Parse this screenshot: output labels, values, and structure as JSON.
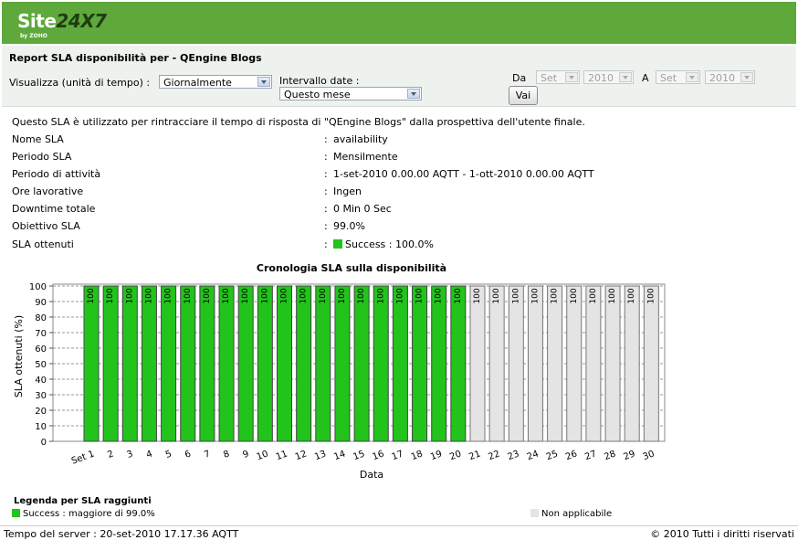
{
  "header": {
    "logo_site": "Site",
    "logo_num": "24X7",
    "logo_sub": "by ZOHO"
  },
  "toolbar": {
    "title": "Report SLA disponibilità per - QEngine Blogs",
    "view_label": "Visualizza (unità di tempo) :",
    "view_value": "Giornalmente",
    "interval_label": "Intervallo date :",
    "interval_value": "Questo mese",
    "from_label": "Da",
    "from_month": "Set",
    "from_year": "2010",
    "to_label": "A",
    "to_month": "Set",
    "to_year": "2010",
    "go_label": "Vai"
  },
  "description": "Questo SLA è utilizzato per rintracciare il tempo di risposta di \"QEngine Blogs\" dalla prospettiva dell'utente finale.",
  "details": [
    {
      "label": "Nome SLA",
      "value": "availability"
    },
    {
      "label": "Periodo SLA",
      "value": "Mensilmente"
    },
    {
      "label": "Periodo di attività",
      "value": "1-set-2010 0.00.00 AQTT - 1-ott-2010 0.00.00 AQTT"
    },
    {
      "label": "Ore lavorative",
      "value": "Ingen"
    },
    {
      "label": "Downtime totale",
      "value": "0 Min 0 Sec"
    },
    {
      "label": "Obiettivo SLA",
      "value": "99.0%"
    },
    {
      "label": "SLA ottenuti",
      "value": "Success : 100.0%"
    }
  ],
  "colors": {
    "success": "#22c41c",
    "na": "#e4e4e4",
    "header_green": "#5ea83c"
  },
  "chart_data": {
    "type": "bar",
    "title": "Cronologia SLA sulla disponibilità",
    "xlabel": "Data",
    "ylabel": "SLA ottenuti (%)",
    "ylim": [
      0,
      100
    ],
    "yticks": [
      0,
      10,
      20,
      30,
      40,
      50,
      60,
      70,
      80,
      90,
      100
    ],
    "categories": [
      "Set 1",
      "2",
      "3",
      "4",
      "5",
      "6",
      "7",
      "8",
      "9",
      "10",
      "11",
      "12",
      "13",
      "14",
      "15",
      "16",
      "17",
      "18",
      "19",
      "20",
      "21",
      "22",
      "23",
      "24",
      "25",
      "26",
      "27",
      "28",
      "29",
      "30"
    ],
    "values": [
      100,
      100,
      100,
      100,
      100,
      100,
      100,
      100,
      100,
      100,
      100,
      100,
      100,
      100,
      100,
      100,
      100,
      100,
      100,
      100,
      100,
      100,
      100,
      100,
      100,
      100,
      100,
      100,
      100,
      100
    ],
    "status": [
      "success",
      "success",
      "success",
      "success",
      "success",
      "success",
      "success",
      "success",
      "success",
      "success",
      "success",
      "success",
      "success",
      "success",
      "success",
      "success",
      "success",
      "success",
      "success",
      "success",
      "na",
      "na",
      "na",
      "na",
      "na",
      "na",
      "na",
      "na",
      "na",
      "na"
    ],
    "grid": true
  },
  "legend": {
    "title": "Legenda per SLA raggiunti",
    "success_label": "Success :  maggiore di  99.0%",
    "na_label": "Non applicabile"
  },
  "footer": {
    "server_time": "Tempo del server : 20-set-2010 17.17.36 AQTT",
    "copyright": "© 2010 Tutti i diritti riservati"
  }
}
